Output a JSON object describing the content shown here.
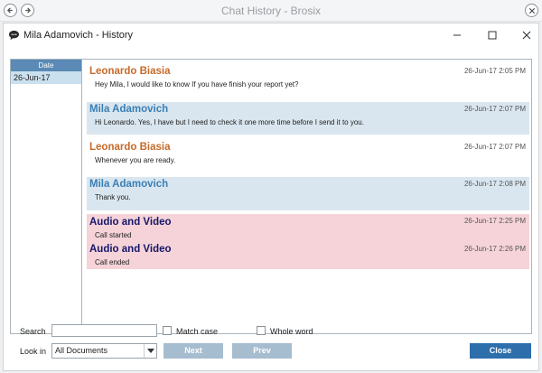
{
  "outer_window": {
    "title": "Chat History - Brosix",
    "icons": {
      "back": "back-arrow-icon",
      "forward": "forward-arrow-icon",
      "close": "close-icon"
    }
  },
  "window": {
    "title": "Mila Adamovich - History",
    "icon": "chat-bubble-icon",
    "controls": {
      "minimize": "minimize-icon",
      "maximize": "maximize-icon",
      "close": "close-icon"
    }
  },
  "dates": {
    "header": "Date",
    "items": [
      "26-Jun-17"
    ],
    "selected": 0
  },
  "messages": [
    {
      "sender": "Leonardo Biasia",
      "time": "26-Jun-17 2:05 PM",
      "text": "Hey Mila, I would like to know If you have finish your report yet?",
      "style": "plain",
      "sender_color": "#c66a2a"
    },
    {
      "sender": "Mila Adamovich",
      "time": "26-Jun-17 2:07 PM",
      "text": "Hi Leonardo. Yes, I have but I need to check it one more time before I send it to you.",
      "style": "alt",
      "sender_color": "#3a7fb5"
    },
    {
      "sender": "Leonardo Biasia",
      "time": "26-Jun-17 2:07 PM",
      "text": "Whenever you are ready.",
      "style": "plain",
      "sender_color": "#c66a2a"
    },
    {
      "sender": "Mila Adamovich",
      "time": "26-Jun-17 2:08 PM",
      "text": "Thank you.",
      "style": "alt",
      "sender_color": "#3a7fb5"
    },
    {
      "sender": "Audio and Video",
      "time": "26-Jun-17 2:25 PM",
      "text": "Call started",
      "style": "av",
      "sender_color": "#17166a"
    },
    {
      "sender": "Audio and Video",
      "time": "26-Jun-17 2:26 PM",
      "text": "Call ended",
      "style": "av",
      "sender_color": "#17166a"
    }
  ],
  "search": {
    "label": "Search",
    "value": "",
    "match_case_label": "Match case",
    "match_case_checked": false,
    "whole_word_label": "Whole word",
    "whole_word_checked": false
  },
  "lookin": {
    "label": "Look in",
    "selected": "All Documents"
  },
  "buttons": {
    "next": "Next",
    "prev": "Prev",
    "close": "Close"
  },
  "colors": {
    "accent": "#2d6eab",
    "disabled_button": "#a6bccf",
    "date_header": "#5a8ab5",
    "alt_row": "#d9e6ef",
    "av_row": "#f5d3d8"
  }
}
